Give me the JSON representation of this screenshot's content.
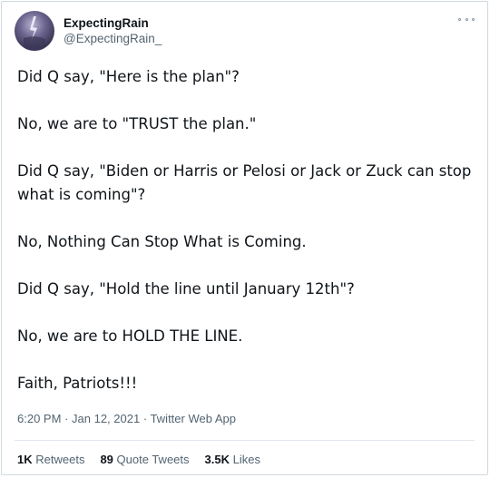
{
  "author": {
    "display_name": "ExpectingRain",
    "handle": "@ExpectingRain_"
  },
  "tweet": {
    "paragraphs": [
      "Did Q say, \"Here is the plan\"?",
      "No, we are to \"TRUST the plan.\"",
      "Did Q say, \"Biden or Harris or Pelosi or Jack or Zuck can stop what is coming\"?",
      "No, Nothing Can Stop What is Coming.",
      "Did Q say, \"Hold the line until January 12th\"?",
      "No, we are to HOLD THE LINE.",
      "Faith, Patriots!!!"
    ]
  },
  "meta": {
    "time": "6:20 PM",
    "separator": "·",
    "date": "Jan 12, 2021",
    "source": "Twitter Web App"
  },
  "stats": {
    "retweets_count": "1K",
    "retweets_label": "Retweets",
    "quotes_count": "89",
    "quotes_label": "Quote Tweets",
    "likes_count": "3.5K",
    "likes_label": "Likes"
  },
  "icons": {
    "avatar": "storm-lightning-avatar",
    "more": "more-options-icon"
  },
  "colors": {
    "text": "#0f1419",
    "secondary_text": "#536471",
    "border": "#cfd9de",
    "divider": "#e1e8ed"
  }
}
